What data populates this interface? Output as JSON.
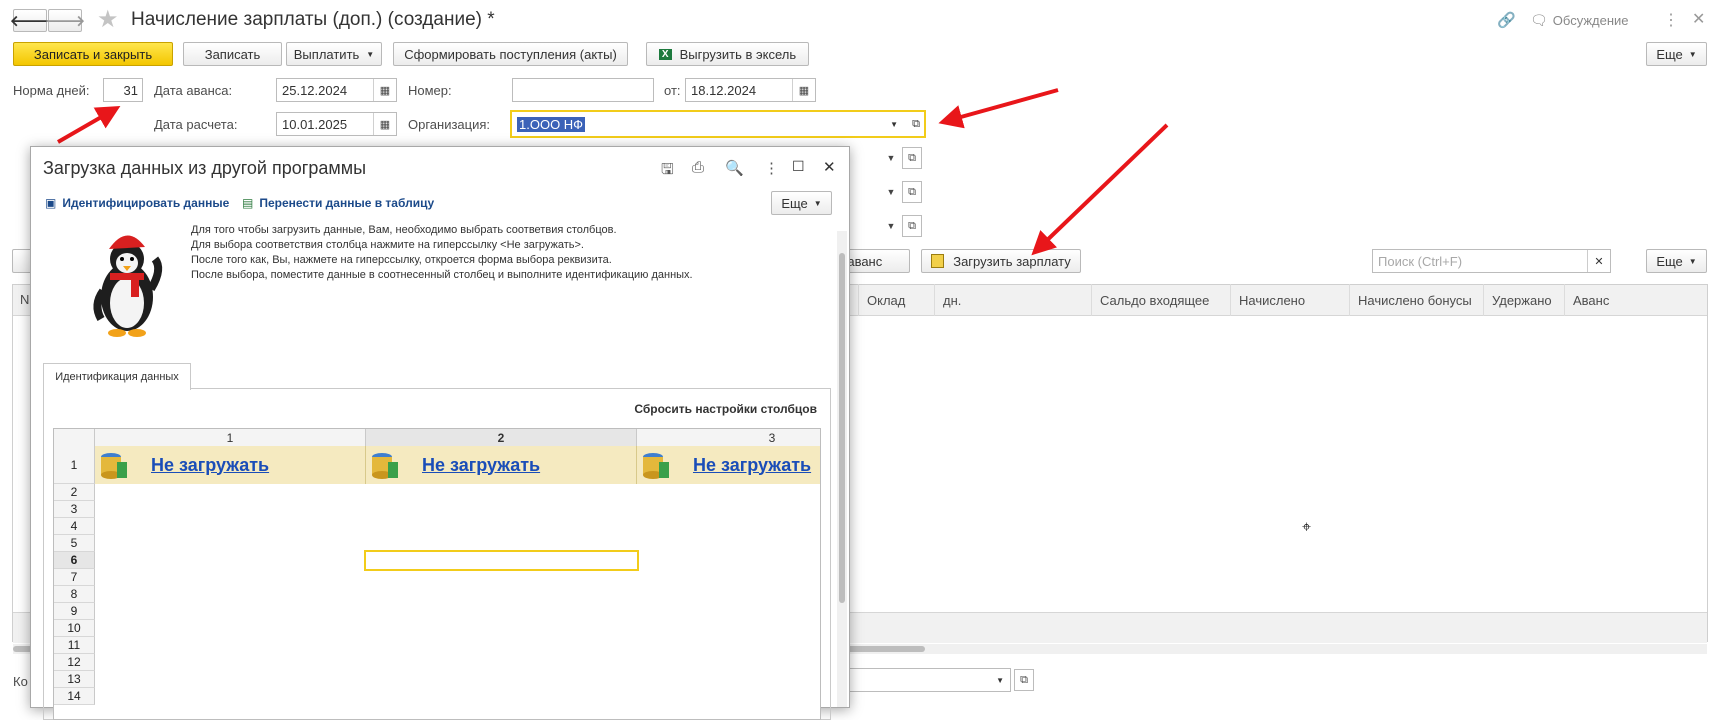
{
  "window": {
    "title": "Начисление зарплаты (доп.) (создание) *",
    "discussion": "Обсуждение"
  },
  "toolbar": {
    "save_close": "Записать и закрыть",
    "save": "Записать",
    "pay": "Выплатить",
    "receipts": "Сформировать поступления (акты)",
    "export_excel": "Выгрузить в эксель",
    "more": "Еще"
  },
  "form": {
    "norm_days_label": "Норма дней:",
    "norm_days_value": "31",
    "advance_date_label": "Дата аванса:",
    "advance_date_value": "25.12.2024",
    "number_label": "Номер:",
    "number_value": "",
    "from_label": "от:",
    "from_value": "18.12.2024",
    "calc_date_label": "Дата расчета:",
    "calc_date_value": "10.01.2025",
    "org_label": "Организация:",
    "org_value": "1.ООО НФ"
  },
  "table_bar": {
    "advance_btn_partial": "ть аванс",
    "load_salary": "Загрузить зарплату",
    "search_placeholder": "Поиск (Ctrl+F)",
    "more": "Еще"
  },
  "table": {
    "first_col_partial": "N",
    "columns": [
      "Оклад",
      "дн.",
      "Сальдо входящее",
      "Начислено",
      "Начислено бонусы",
      "Удержано",
      "Аванс"
    ]
  },
  "footer": {
    "label_partial": "Ко"
  },
  "dialog": {
    "title": "Загрузка данных из другой программы",
    "identify_link": "Идентифицировать данные",
    "transfer_link": "Перенести данные в таблицу",
    "more": "Еще",
    "instructions": [
      "Для того чтобы загрузить данные, Вам, необходимо выбрать соответвия столбцов.",
      "Для выбора соответствия столбца нажмите на гиперссылку <Не загружать>.",
      "После того как, Вы, нажмете на гиперссылку, откроется форма выбора реквизита.",
      "После выбора, поместите данные в соотнесенный столбец и выполните идентификацию данных."
    ],
    "tab": "Идентификация данных",
    "reset": "Сбросить настройки столбцов",
    "grid": {
      "col_numbers": [
        "1",
        "2",
        "3"
      ],
      "header_row_number": "1",
      "cell_text": "Не загружать",
      "row_numbers": [
        "2",
        "3",
        "4",
        "5",
        "6",
        "7",
        "8",
        "9",
        "10",
        "11",
        "12",
        "13",
        "14"
      ]
    }
  },
  "colors": {
    "accent_yellow": "#f3c600",
    "annotation_arrow": "#e8161a",
    "link_blue": "#1a4db8"
  }
}
